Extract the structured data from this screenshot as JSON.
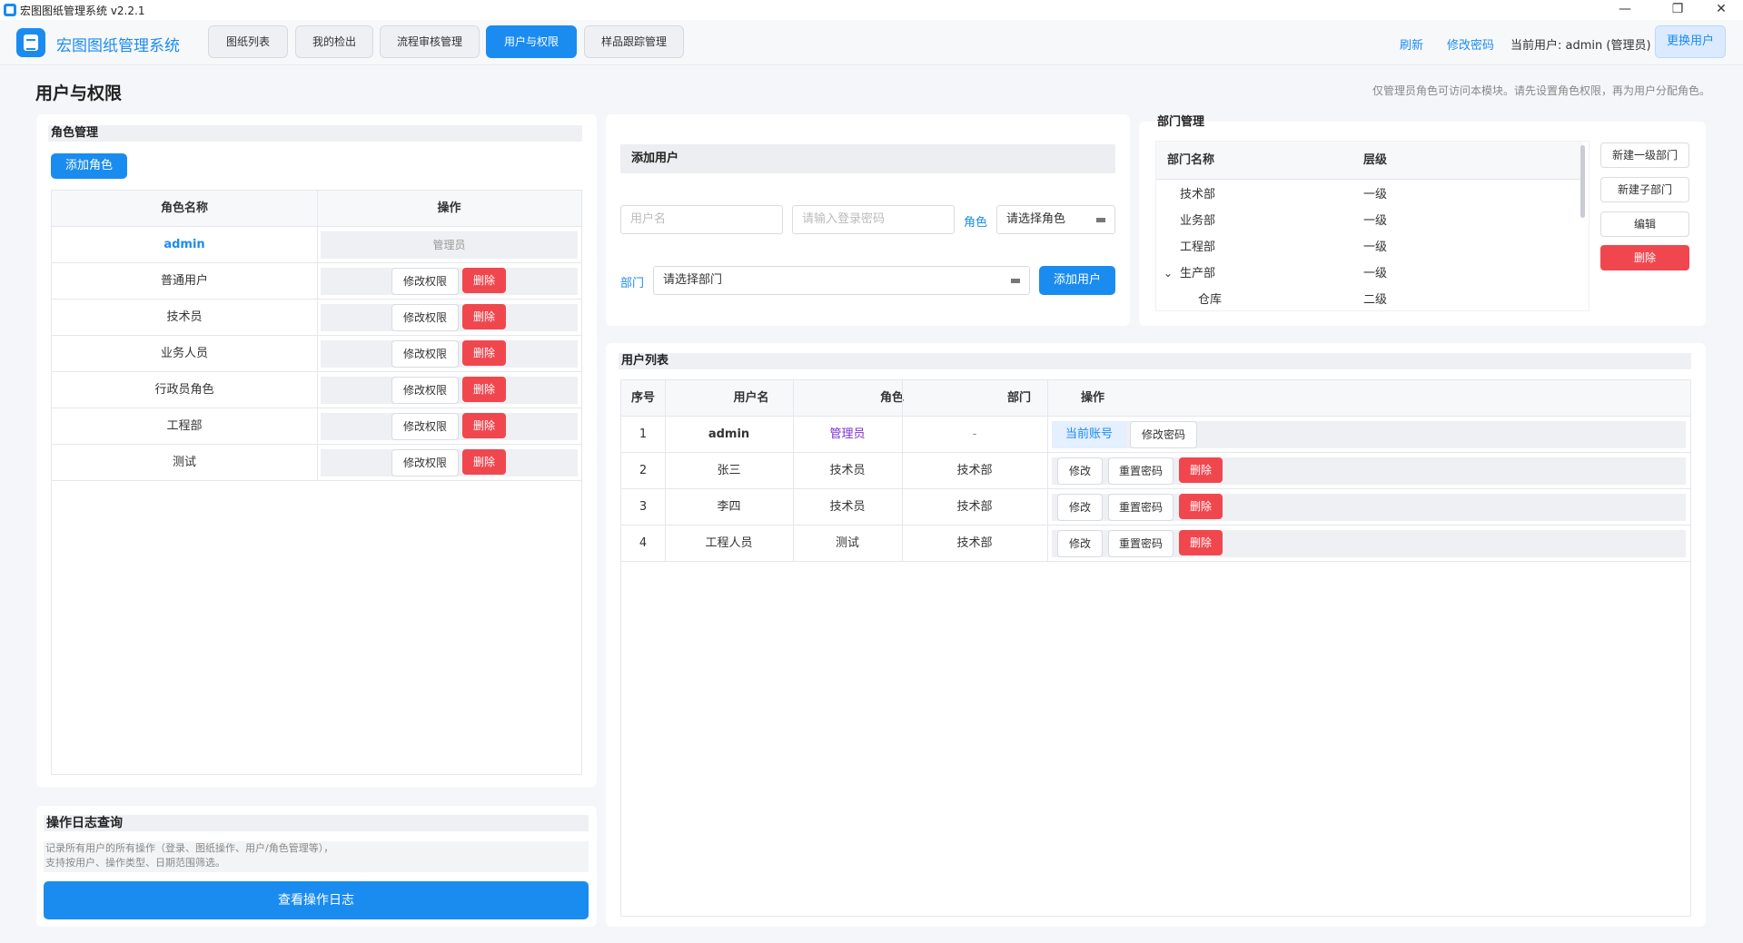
{
  "window": {
    "title": "宏图图纸管理系统  v2.2.1",
    "minimize": "—",
    "restore": "❐",
    "close": "✕"
  },
  "header": {
    "app_name": "宏图图纸管理系统",
    "tabs": [
      "图纸列表",
      "我的检出",
      "流程审核管理",
      "用户与权限",
      "样品跟踪管理"
    ],
    "active_tab": "用户与权限",
    "refresh": "刷新",
    "change_password": "修改密码",
    "current_user": "当前用户: admin (管理员)",
    "switch_user": "更换用户"
  },
  "page": {
    "title": "用户与权限",
    "hint": "仅管理员角色可访问本模块。请先设置角色权限，再为用户分配角色。"
  },
  "roles": {
    "section_title": "角色管理",
    "add_button": "添加角色",
    "columns": [
      "角色名称",
      "操作"
    ],
    "rows": [
      {
        "name": "admin",
        "note": "管理员"
      },
      {
        "name": "普通用户"
      },
      {
        "name": "技术员"
      },
      {
        "name": "业务人员"
      },
      {
        "name": "行政员角色"
      },
      {
        "name": "工程部"
      },
      {
        "name": "测试"
      }
    ],
    "edit_label": "修改权限",
    "delete_label": "删除"
  },
  "log": {
    "section_title": "操作日志查询",
    "desc_line1": "记录所有用户的所有操作（登录、图纸操作、用户/角色管理等），",
    "desc_line2": "支持按用户、操作类型、日期范围筛选。",
    "button": "查看操作日志"
  },
  "add_user": {
    "section_title": "添加用户",
    "username_placeholder": "用户名",
    "password_placeholder": "请输入登录密码",
    "role_label": "角色",
    "role_value": "请选择角色",
    "dept_label": "部门",
    "dept_value": "请选择部门",
    "submit": "添加用户"
  },
  "departments": {
    "section_title": "部门管理",
    "columns": [
      "部门名称",
      "层级"
    ],
    "rows": [
      {
        "name": "技术部",
        "level": "一级"
      },
      {
        "name": "业务部",
        "level": "一级"
      },
      {
        "name": "工程部",
        "level": "一级"
      },
      {
        "name": "生产部",
        "level": "一级",
        "expanded": "⌄"
      },
      {
        "name": "仓库",
        "level": "二级"
      }
    ],
    "buttons": {
      "new_top": "新建一级部门",
      "new_child": "新建子部门",
      "edit": "编辑",
      "delete": "删除"
    }
  },
  "users": {
    "section_title": "用户列表",
    "columns": [
      "序号",
      "用户名",
      "角色",
      "部门",
      "操作"
    ],
    "rows": [
      {
        "no": "1",
        "username": "admin",
        "role": "管理员",
        "dept": "-",
        "current": "当前账号",
        "action": "修改密码"
      },
      {
        "no": "2",
        "username": "张三",
        "role": "技术员",
        "dept": "技术部"
      },
      {
        "no": "3",
        "username": "李四",
        "role": "技术员",
        "dept": "技术部"
      },
      {
        "no": "4",
        "username": "工程人员",
        "role": "测试",
        "dept": "技术部"
      }
    ],
    "edit_label": "修改",
    "reset_label": "重置密码",
    "delete_label": "删除"
  },
  "colors": {
    "accent": "#1a8cf0",
    "danger": "#f0474f",
    "role_admin": "#7a2fd0"
  }
}
